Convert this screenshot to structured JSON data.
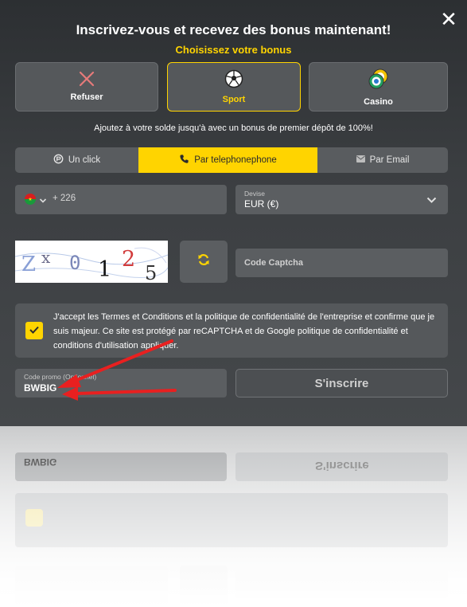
{
  "modal": {
    "title": "Inscrivez-vous et recevez des bonus maintenant!",
    "subtitle": "Choisissez votre bonus",
    "close_label": "✕"
  },
  "bonus_options": [
    {
      "label": "Refuser",
      "icon": "x-icon",
      "active": false
    },
    {
      "label": "Sport",
      "icon": "soccer-ball-icon",
      "active": true
    },
    {
      "label": "Casino",
      "icon": "casino-chips-icon",
      "active": false
    }
  ],
  "info_text": "Ajoutez à votre solde jusqu'à avec un bonus de premier dépôt de 100%!",
  "tabs": [
    {
      "label": "Un click",
      "icon": "one-click-icon",
      "active": false
    },
    {
      "label": "Par telephonephone",
      "icon": "phone-icon",
      "active": true
    },
    {
      "label": "Par Email",
      "icon": "envelope-icon",
      "active": false
    }
  ],
  "phone": {
    "country": "Burkina Faso",
    "code": "+ 226",
    "value": ""
  },
  "currency": {
    "label": "Devise",
    "value": "EUR (€)"
  },
  "captcha": {
    "image_text": "Zx0125",
    "placeholder": "Code Captcha"
  },
  "terms": {
    "text": "J'accept les Termes et Conditions et la politique de confidentialité de l'entreprise et confirme que je suis majeur. Ce site est protégé par reCAPTCHA et de Google politique de confidentialité et conditions d'utilisation appliquer.",
    "checked": true
  },
  "promo": {
    "label": "Code promo (Optionnel)",
    "value": "BWBIG"
  },
  "signup_label": "S'inscrire",
  "colors": {
    "accent": "#ffd400",
    "annotation_arrow": "#e82020"
  }
}
